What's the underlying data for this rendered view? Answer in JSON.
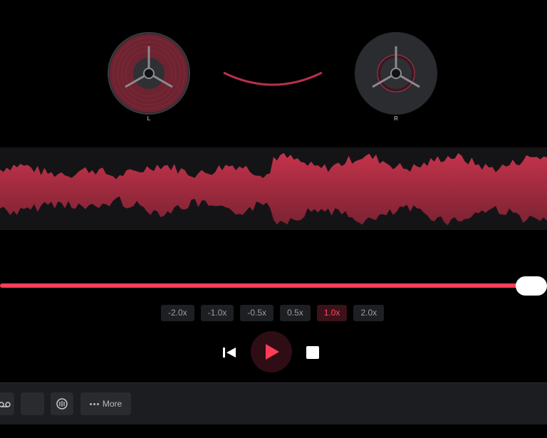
{
  "reels": {
    "left_label": "L",
    "right_label": "R"
  },
  "colors": {
    "accent": "#ff3d57",
    "wave_top": "#c4334b",
    "wave_bottom": "#7a2232",
    "background": "#000000"
  },
  "playback": {
    "progress": 0.97
  },
  "speed_options": [
    {
      "label": "-2.0x",
      "active": false
    },
    {
      "label": "-1.0x",
      "active": false
    },
    {
      "label": "-0.5x",
      "active": false
    },
    {
      "label": "0.5x",
      "active": false
    },
    {
      "label": "1.0x",
      "active": true
    },
    {
      "label": "2.0x",
      "active": false
    }
  ],
  "transport": {
    "skip_back_icon": "skip-back-icon",
    "play_icon": "play-icon",
    "stop_icon": "stop-icon"
  },
  "toolbar": {
    "more_label": "More",
    "icons": [
      "cassette-icon",
      "blank-tool",
      "broadcast-icon",
      "more-dots-icon"
    ]
  }
}
